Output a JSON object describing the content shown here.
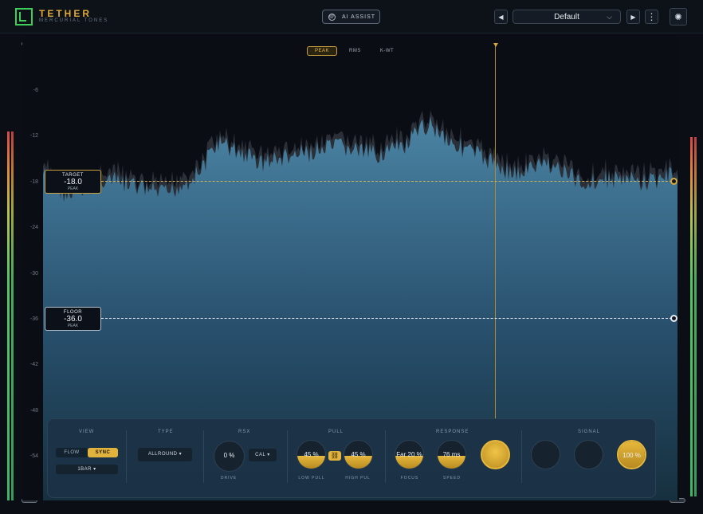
{
  "header": {
    "brand": "TETHER",
    "brand_sub": "MERCURIAL TONES",
    "ai_button": "AI ASSIST",
    "preset": "Default",
    "prev_icon": "◀",
    "next_icon": "▶",
    "menu_icon": "⋮",
    "settings_icon": "✺",
    "chevron_icon": "⌵"
  },
  "graph": {
    "tabs": [
      "PEAK",
      "RMS",
      "K-WT"
    ],
    "active_tab": "PEAK",
    "scale": [
      "-6",
      "-12",
      "-18",
      "-24",
      "-30",
      "-36",
      "-42",
      "-48",
      "-54"
    ],
    "target": {
      "title": "TARGET",
      "value": "-18.0",
      "mode": "PEAK",
      "db": -18
    },
    "floor": {
      "title": "FLOOR",
      "value": "-36.0",
      "mode": "PEAK",
      "db": -36
    }
  },
  "panel": {
    "view": {
      "title": "VIEW",
      "flow": "FLOW",
      "sync": "SYNC",
      "rate": "1BAR ▾"
    },
    "type": {
      "title": "TYPE",
      "value": "ALLROUND ▾"
    },
    "rsx": {
      "title": "RSX",
      "drive_value": "0 %",
      "drive_label": "DRIVE",
      "cal": "CAL ▾"
    },
    "pull": {
      "title": "PULL",
      "low_value": "45 %",
      "low_label": "LOW PULL",
      "high_value": "45 %",
      "high_label": "HIGH PUL",
      "low_level": 0.45,
      "high_level": 0.45
    },
    "response": {
      "title": "RESPONSE",
      "focus_value": "Far 20 %",
      "focus_label": "FOCUS",
      "speed_value": "76 ms",
      "speed_label": "SPEED",
      "speed_level": 0.45
    },
    "signal": {
      "title": "SIGNAL",
      "mix_value": "100 %",
      "mix_level": 1.0
    }
  }
}
